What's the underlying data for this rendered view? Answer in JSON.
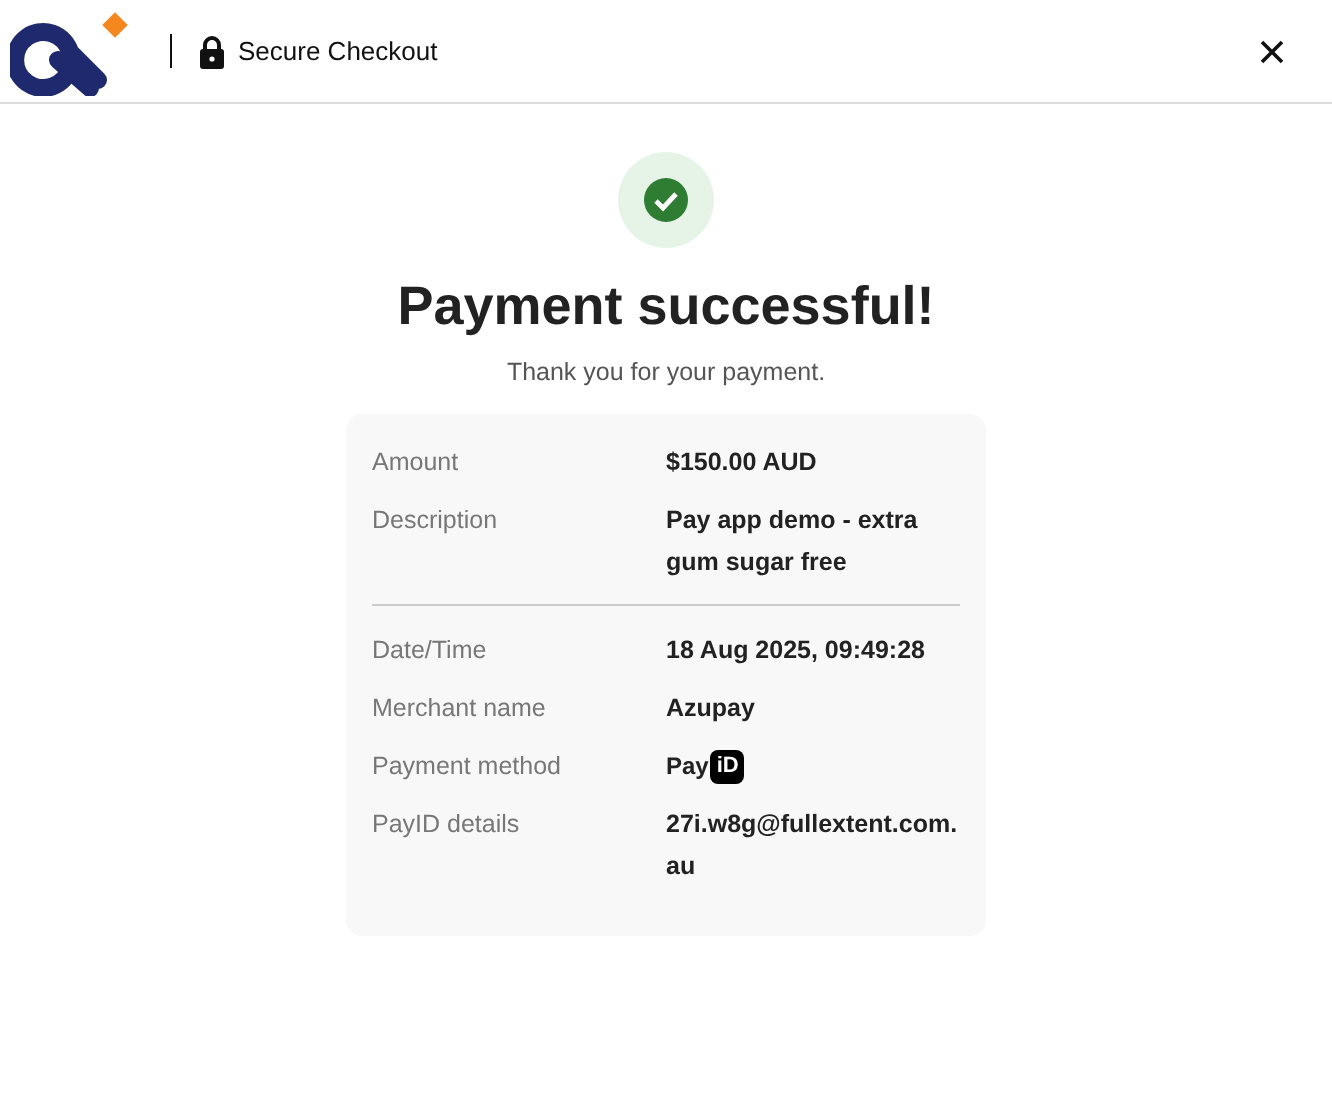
{
  "header": {
    "title": "Secure Checkout"
  },
  "status": {
    "title": "Payment successful!",
    "message": "Thank you for your payment."
  },
  "sections": [
    [
      {
        "label": "Amount",
        "kind": "text",
        "value": "$150.00 AUD"
      },
      {
        "label": "Description",
        "kind": "text",
        "value": "Pay app demo - extra gum sugar free"
      }
    ],
    [
      {
        "label": "Date/Time",
        "kind": "text",
        "value": "18 Aug 2025, 09:49:28"
      },
      {
        "label": "Merchant name",
        "kind": "text",
        "value": "Azupay"
      },
      {
        "label": "Payment method",
        "kind": "logo",
        "value": "Pay",
        "badge": "iD"
      },
      {
        "label": "PayID details",
        "kind": "text",
        "value": "27i.w8g@fullextent.com.au"
      }
    ]
  ]
}
